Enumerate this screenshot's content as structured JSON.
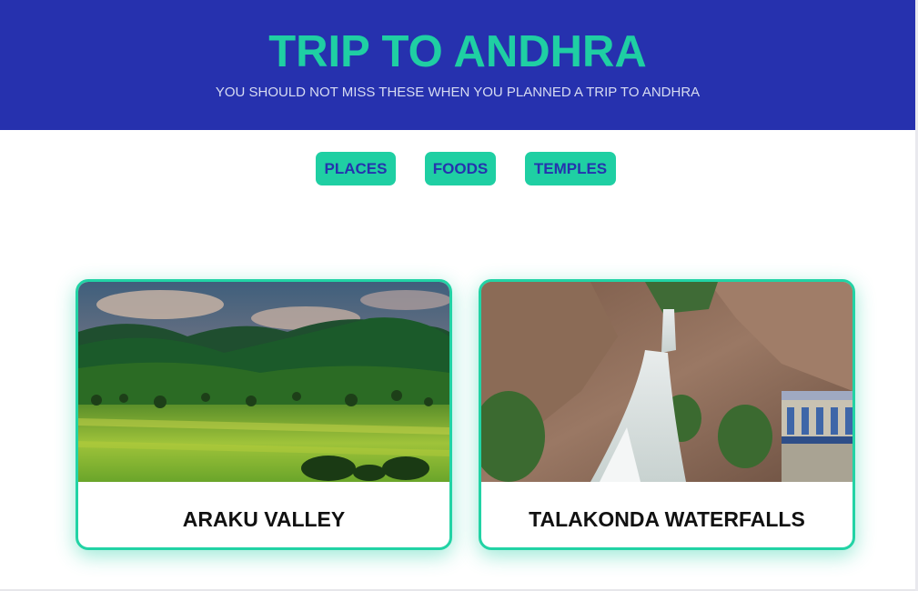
{
  "header": {
    "title": "TRIP TO ANDHRA",
    "subtitle": "YOU SHOULD NOT MISS THESE WHEN YOU PLANNED A TRIP TO ANDHRA"
  },
  "nav": {
    "items": [
      {
        "label": "PLACES"
      },
      {
        "label": "FOODS"
      },
      {
        "label": "TEMPLES"
      }
    ]
  },
  "cards": [
    {
      "label": "ARAKU VALLEY",
      "image": "valley-landscape-photo"
    },
    {
      "label": "TALAKONDA WATERFALLS",
      "image": "waterfall-photo"
    }
  ],
  "colors": {
    "header_bg": "#2631ae",
    "accent": "#1fcfa3",
    "nav_text": "#2533ae",
    "card_border": "#22d3a5"
  }
}
